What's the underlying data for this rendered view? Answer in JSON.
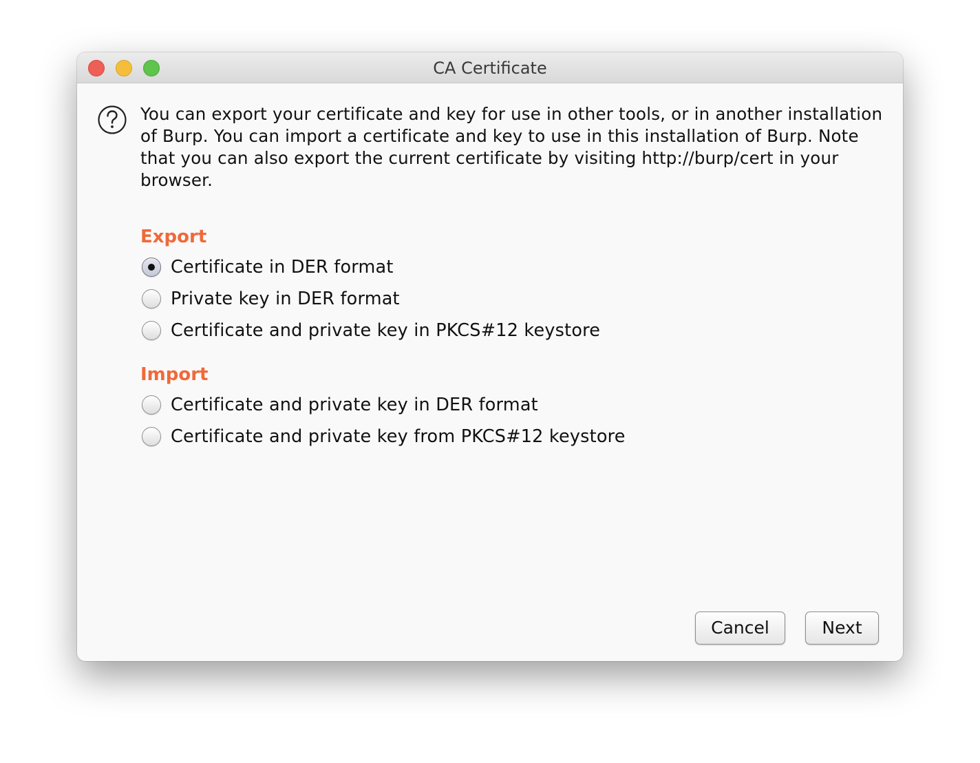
{
  "window": {
    "title": "CA Certificate"
  },
  "dialog": {
    "message": "You can export your certificate and key for use in other tools, or in another installation of Burp. You can import a certificate and key to use in this installation of Burp. Note that you can also export the current certificate by visiting http://burp/cert in your browser.",
    "accent_color": "#f0693a"
  },
  "export": {
    "heading": "Export",
    "options": [
      {
        "label": "Certificate in DER format",
        "selected": true
      },
      {
        "label": "Private key in DER format",
        "selected": false
      },
      {
        "label": "Certificate and private key in PKCS#12 keystore",
        "selected": false
      }
    ]
  },
  "import": {
    "heading": "Import",
    "options": [
      {
        "label": "Certificate and private key in DER format",
        "selected": false
      },
      {
        "label": "Certificate and private key from PKCS#12 keystore",
        "selected": false
      }
    ]
  },
  "buttons": {
    "cancel_label": "Cancel",
    "next_label": "Next"
  },
  "icons": {
    "help": "question-mark-icon"
  }
}
